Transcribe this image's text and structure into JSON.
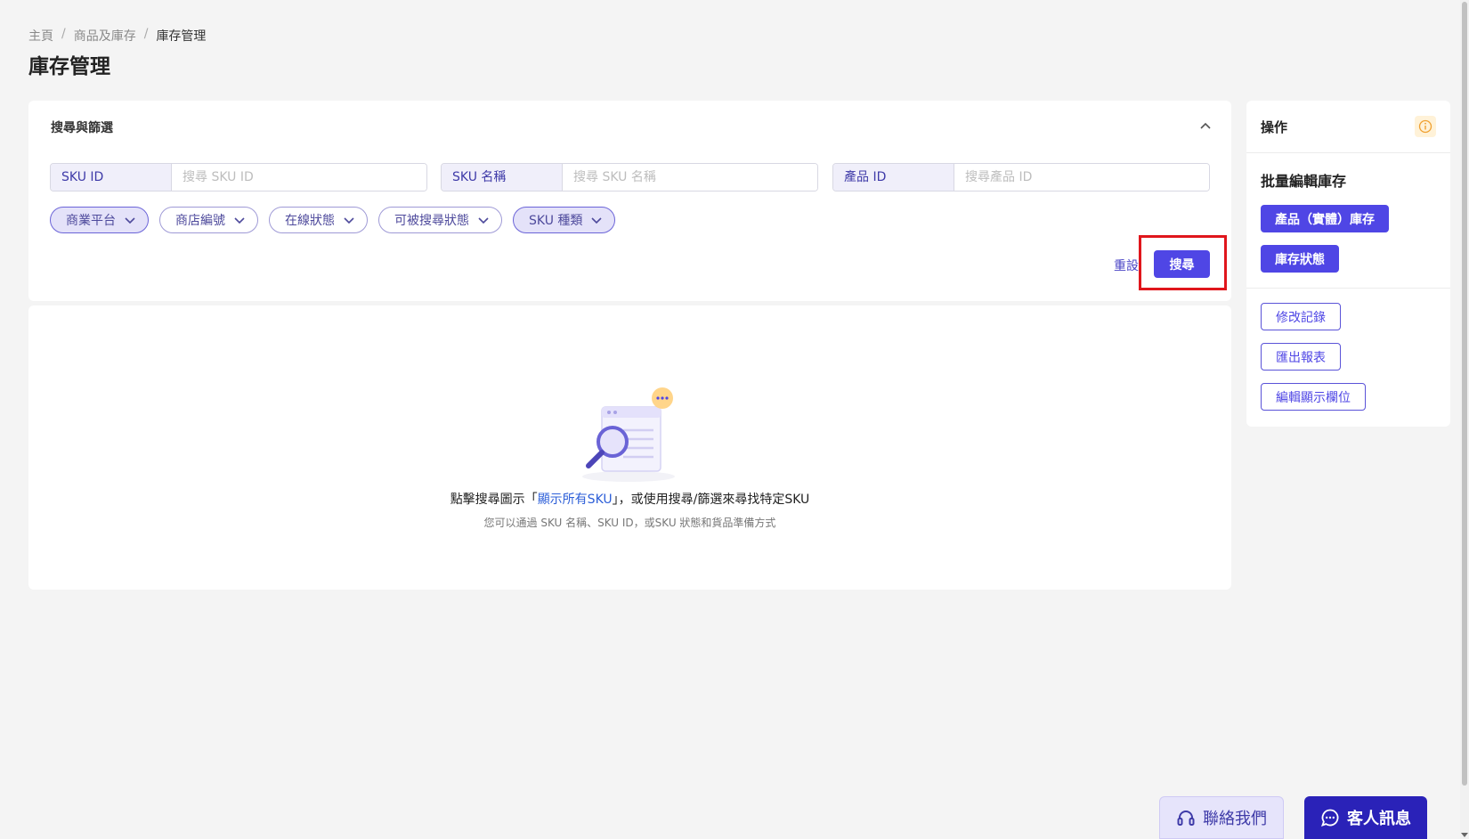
{
  "breadcrumb": {
    "home": "主頁",
    "parent": "商品及庫存",
    "current": "庫存管理"
  },
  "page_title": "庫存管理",
  "filter": {
    "title": "搜尋與篩選",
    "fields": [
      {
        "label": "SKU ID",
        "placeholder": "搜尋 SKU ID"
      },
      {
        "label": "SKU 名稱",
        "placeholder": "搜尋 SKU 名稱"
      },
      {
        "label": "產品 ID",
        "placeholder": "搜尋產品 ID"
      }
    ],
    "chips": [
      {
        "label": "商業平台",
        "active": true
      },
      {
        "label": "商店編號",
        "active": false
      },
      {
        "label": "在線狀態",
        "active": false
      },
      {
        "label": "可被搜尋狀態",
        "active": false
      },
      {
        "label": "SKU 種類",
        "active": true
      }
    ],
    "reset_label": "重設",
    "search_label": "搜尋"
  },
  "empty_state": {
    "title_prefix": "點擊搜尋圖示「",
    "title_link": "顯示所有SKU",
    "title_suffix": "」，或使用搜尋/篩選來尋找特定SKU",
    "subtitle": "您可以通過 SKU 名稱、SKU ID，或SKU 狀態和貨品準備方式"
  },
  "actions": {
    "title": "操作",
    "bulk_title": "批量編輯庫存",
    "primary_buttons": [
      "產品（實體）庫存",
      "庫存狀態"
    ],
    "secondary_buttons": [
      "修改記錄",
      "匯出報表",
      "編輯顯示欄位"
    ]
  },
  "footer": {
    "contact_label": "聯絡我們",
    "message_label": "客人訊息"
  },
  "colors": {
    "accent": "#4f46e5",
    "highlight": "#e0161c",
    "link": "#2d5fd8"
  }
}
